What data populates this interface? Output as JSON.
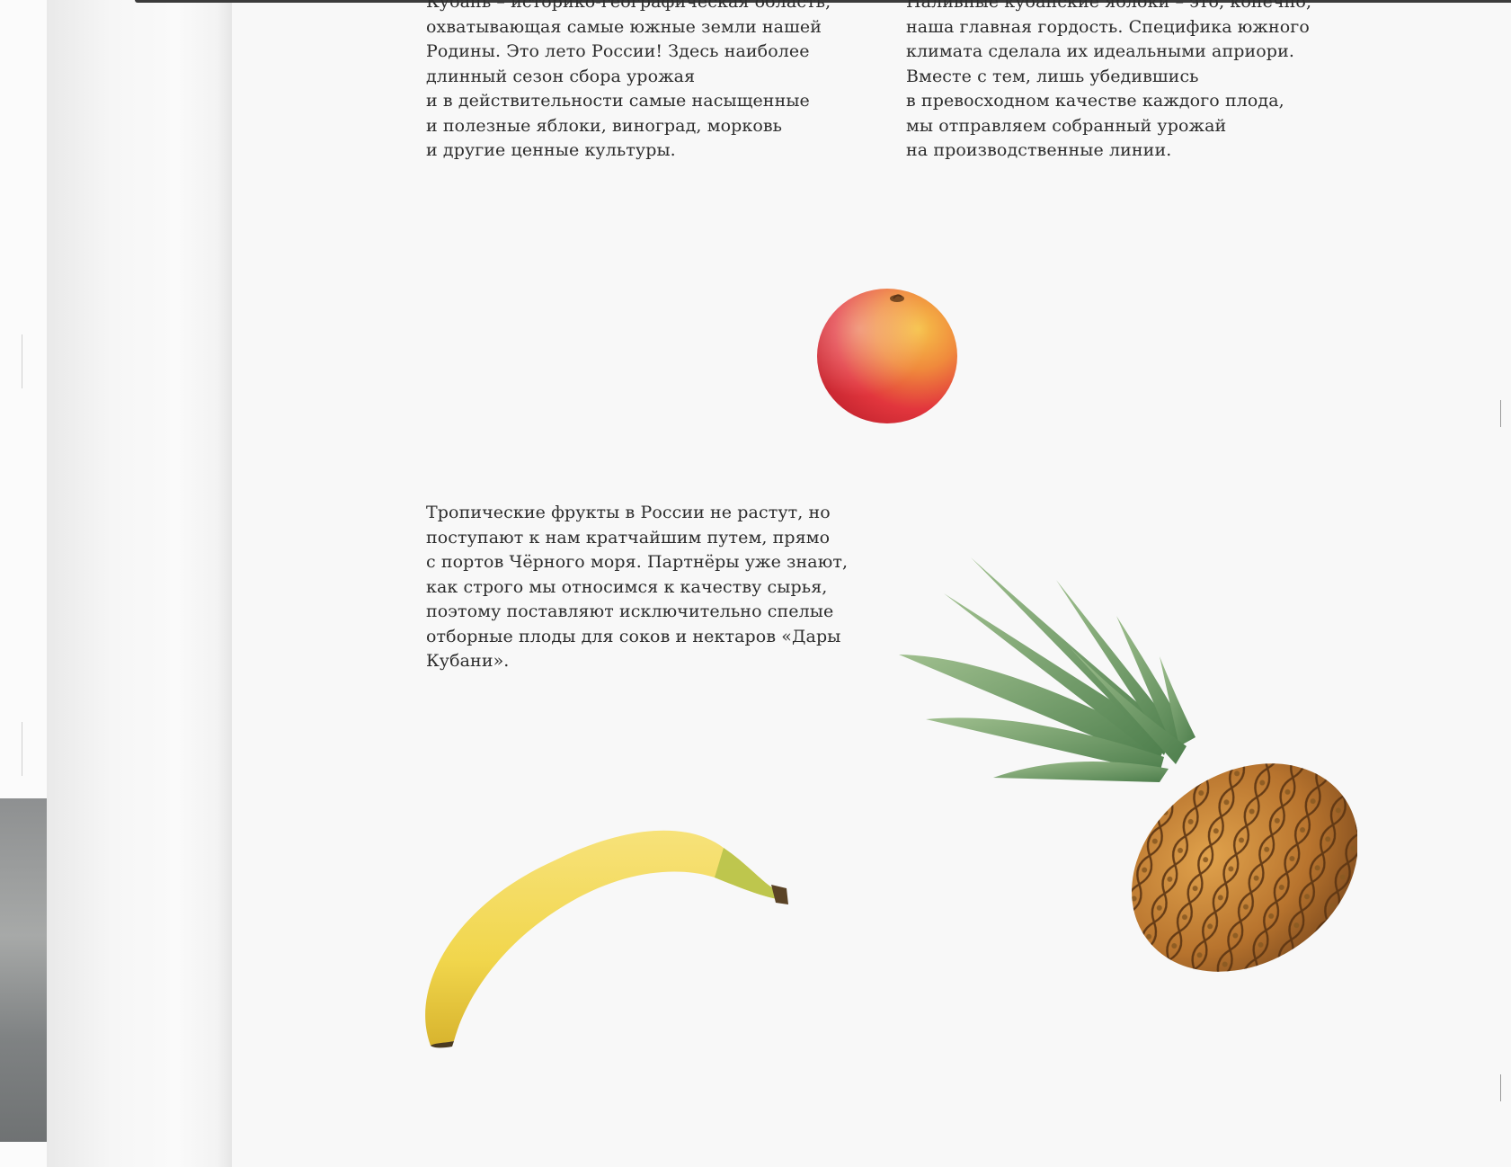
{
  "article": {
    "paragraph_1": "Кубань – историко-географическая область,\nохватывающая самые южные земли нашей\nРодины. Это лето России! Здесь наиболее\nдлинный сезон сбора урожая\nи в действительности самые насыщенные\nи полезные яблоки, виноград, морковь\nи другие ценные культуры.",
    "paragraph_2": "Наливные кубанские яблоки – это, конечно,\nнаша главная гордость. Специфика южного\nклимата сделала их идеальными априори.\nВместе с тем, лишь убедившись\nв превосходном качестве каждого плода,\nмы отправляем собранный урожай\nна производственные линии.",
    "paragraph_3": "Тропические фрукты в России не растут, но\nпоступают к нам кратчайшим путем, прямо\nс портов Чёрного моря. Партнёры уже знают,\nкак строго мы относимся к качеству сырья,\nпоэтому поставляют исключительно спелые\nотборные плоды для соков и нектаров «Дары\nКубани»."
  },
  "colors": {
    "text": "#2d2d2d",
    "page": "#f8f8f8",
    "apple_red": "#e2363d",
    "apple_yellow": "#f2b33f",
    "banana": "#f1d64c",
    "pineapple_skin": "#c98a3a",
    "pineapple_leaf": "#6f9a67"
  }
}
